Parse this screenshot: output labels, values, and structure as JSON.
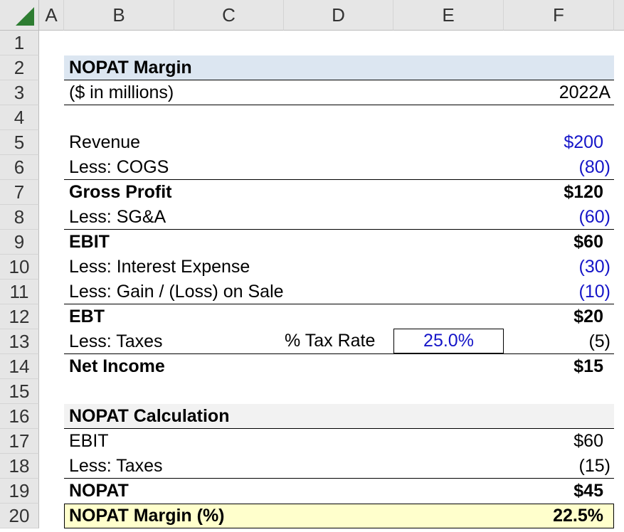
{
  "columns": [
    "A",
    "B",
    "C",
    "D",
    "E",
    "F"
  ],
  "rows": [
    "1",
    "2",
    "3",
    "4",
    "5",
    "6",
    "7",
    "8",
    "9",
    "10",
    "11",
    "12",
    "13",
    "14",
    "15",
    "16",
    "17",
    "18",
    "19",
    "20"
  ],
  "title": "NOPAT Margin",
  "units": "($ in millions)",
  "period": "2022A",
  "income_statement": [
    {
      "label": "Revenue",
      "value": "$200"
    },
    {
      "label": "Less: COGS",
      "value": "(80)"
    },
    {
      "label": "Gross Profit",
      "value": "$120"
    },
    {
      "label": "Less: SG&A",
      "value": "(60)"
    },
    {
      "label": "EBIT",
      "value": "$60"
    },
    {
      "label": "Less: Interest Expense",
      "value": "(30)"
    },
    {
      "label": "Less: Gain / (Loss) on Sale",
      "value": "(10)"
    },
    {
      "label": "EBT",
      "value": "$20"
    },
    {
      "label": "Less: Taxes",
      "value": "(5)"
    },
    {
      "label": "Net Income",
      "value": "$15"
    }
  ],
  "tax": {
    "label": "% Tax Rate",
    "value": "25.0%"
  },
  "nopat_section": {
    "title": "NOPAT Calculation",
    "rows": [
      {
        "label": "EBIT",
        "value": "$60"
      },
      {
        "label": "Less: Taxes",
        "value": "(15)"
      },
      {
        "label": "NOPAT",
        "value": "$45"
      }
    ]
  },
  "margin": {
    "label": "NOPAT Margin (%)",
    "value": "22.5%"
  },
  "colors": {
    "header_band": "#dce6f1",
    "section_band": "#f2f2f2",
    "highlight": "#ffffcc",
    "input_blue": "#1515c8",
    "corner_green": "#2e7d32"
  }
}
